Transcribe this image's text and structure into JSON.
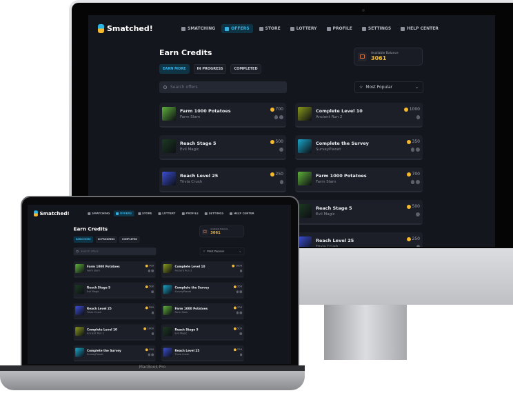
{
  "app": {
    "name": "Smatched!"
  },
  "nav": [
    {
      "label": "SMATCHING",
      "icon": "smatching-icon"
    },
    {
      "label": "OFFERS",
      "icon": "offers-icon",
      "active": true
    },
    {
      "label": "STORE",
      "icon": "store-icon"
    },
    {
      "label": "LOTTERY",
      "icon": "lottery-icon"
    },
    {
      "label": "PROFILE",
      "icon": "profile-icon"
    },
    {
      "label": "SETTINGS",
      "icon": "settings-icon"
    },
    {
      "label": "HELP CENTER",
      "icon": "help-icon"
    }
  ],
  "page": {
    "title": "Earn Credits"
  },
  "balance": {
    "label": "Available Balance",
    "value": "3061"
  },
  "tabs": [
    {
      "label": "EARN MORE",
      "active": true
    },
    {
      "label": "IN PROGRESS"
    },
    {
      "label": "COMPLETED"
    }
  ],
  "search": {
    "placeholder": "Search offers"
  },
  "sort": {
    "value": "Most Popular"
  },
  "offers": [
    {
      "title": "Farm 1000 Potatoes",
      "game": "Farm Slam",
      "points": "700",
      "platforms": [
        "apple",
        "android"
      ],
      "thumb": "#5fb23a"
    },
    {
      "title": "Complete Level 10",
      "game": "Ancient Run 2",
      "points": "1000",
      "platforms": [
        "apple"
      ],
      "thumb": "#8a9a1c"
    },
    {
      "title": "Reach Stage 5",
      "game": "Evil Magic",
      "points": "500",
      "platforms": [
        "android"
      ],
      "thumb": "#1d3a22"
    },
    {
      "title": "Complete the Survey",
      "game": "SurveyPlanet",
      "points": "350",
      "platforms": [
        "apple",
        "android"
      ],
      "thumb": "#1aa6c9"
    },
    {
      "title": "Reach Level 25",
      "game": "Trivia Crush",
      "points": "250",
      "platforms": [
        "apple"
      ],
      "thumb": "#3b4fd6"
    },
    {
      "title": "Farm 1000 Potatoes",
      "game": "Farm Slam",
      "points": "700",
      "platforms": [
        "apple",
        "android"
      ],
      "thumb": "#5fb23a"
    },
    {
      "title": "Complete Level 10",
      "game": "Ancient Run 2",
      "points": "1000",
      "platforms": [
        "apple"
      ],
      "thumb": "#8a9a1c"
    },
    {
      "title": "Reach Stage 5",
      "game": "Evil Magic",
      "points": "500",
      "platforms": [
        "android"
      ],
      "thumb": "#1d3a22"
    },
    {
      "title": "Complete the Survey",
      "game": "SurveyPlanet",
      "points": "350",
      "platforms": [
        "apple",
        "android"
      ],
      "thumb": "#1aa6c9"
    },
    {
      "title": "Reach Level 25",
      "game": "Trivia Crush",
      "points": "250",
      "platforms": [
        "apple"
      ],
      "thumb": "#3b4fd6"
    }
  ],
  "device": {
    "laptop_label": "MacBook Pro"
  }
}
